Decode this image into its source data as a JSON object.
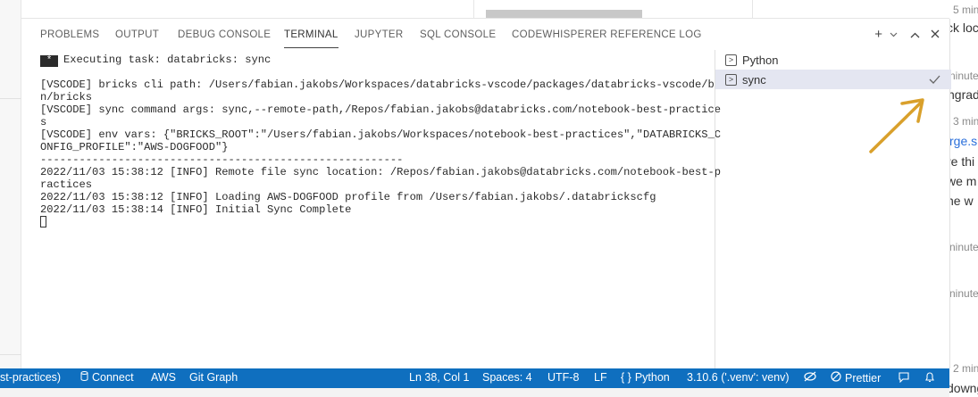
{
  "background_page": {
    "items": [
      {
        "text": "5 min",
        "kind": "meta"
      },
      {
        "text": "ck loc",
        "kind": "text"
      },
      {
        "text": "ninute",
        "kind": "meta"
      },
      {
        "text": "ngrad",
        "kind": "text"
      },
      {
        "text": "3 min",
        "kind": "meta"
      },
      {
        "text": "rge.s",
        "kind": "link"
      },
      {
        "text": "re thi",
        "kind": "text"
      },
      {
        "text": "we m",
        "kind": "text"
      },
      {
        "text": "ne w",
        "kind": "text"
      },
      {
        "text": "ninute",
        "kind": "meta"
      },
      {
        "text": "ninute",
        "kind": "meta"
      },
      {
        "text": "2 min",
        "kind": "meta"
      },
      {
        "text": "downgrad",
        "kind": "text"
      }
    ]
  },
  "panel": {
    "tabs": [
      {
        "label": "PROBLEMS",
        "active": false
      },
      {
        "label": "OUTPUT",
        "active": false
      },
      {
        "label": "DEBUG CONSOLE",
        "active": false
      },
      {
        "label": "TERMINAL",
        "active": true
      },
      {
        "label": "JUPYTER",
        "active": false
      },
      {
        "label": "SQL CONSOLE",
        "active": false
      },
      {
        "label": "CODEWHISPERER REFERENCE LOG",
        "active": false
      }
    ],
    "actions": {
      "new_terminal": "+",
      "dropdown": "v",
      "maximize": "^",
      "close": "×"
    }
  },
  "terminal": {
    "task_icon": "*",
    "task_line": "Executing task: databricks: sync",
    "lines": [
      "",
      "[VSCODE] bricks cli path: /Users/fabian.jakobs/Workspaces/databricks-vscode/packages/databricks-vscode/bi",
      "n/bricks",
      "[VSCODE] sync command args: sync,--remote-path,/Repos/fabian.jakobs@databricks.com/notebook-best-practice",
      "s",
      "[VSCODE] env vars: {\"BRICKS_ROOT\":\"/Users/fabian.jakobs/Workspaces/notebook-best-practices\",\"DATABRICKS_C",
      "ONFIG_PROFILE\":\"AWS-DOGFOOD\"}",
      "--------------------------------------------------------",
      "2022/11/03 15:38:12 [INFO] Remote file sync location: /Repos/fabian.jakobs@databricks.com/notebook-best-p",
      "ractices",
      "2022/11/03 15:38:12 [INFO] Loading AWS-DOGFOOD profile from /Users/fabian.jakobs/.databrickscfg",
      "2022/11/03 15:38:14 [INFO] Initial Sync Complete"
    ]
  },
  "terminal_list": [
    {
      "label": "Python",
      "selected": false,
      "icon": "terminal-icon"
    },
    {
      "label": "sync",
      "selected": true,
      "icon": "terminal-icon",
      "status": "check-icon"
    }
  ],
  "status_bar": {
    "branch": "st-practices)",
    "connect": "Connect",
    "profile": "AWS",
    "git_graph": "Git Graph",
    "position": "Ln 38, Col 1",
    "spaces": "Spaces: 4",
    "encoding": "UTF-8",
    "eol": "LF",
    "language": "Python",
    "interpreter": "3.10.6 ('.venv': venv)",
    "prettier": "Prettier",
    "color": "#0f6fbf"
  },
  "annotation": {
    "color": "#d9a02b",
    "icon": "arrow-annotation"
  }
}
